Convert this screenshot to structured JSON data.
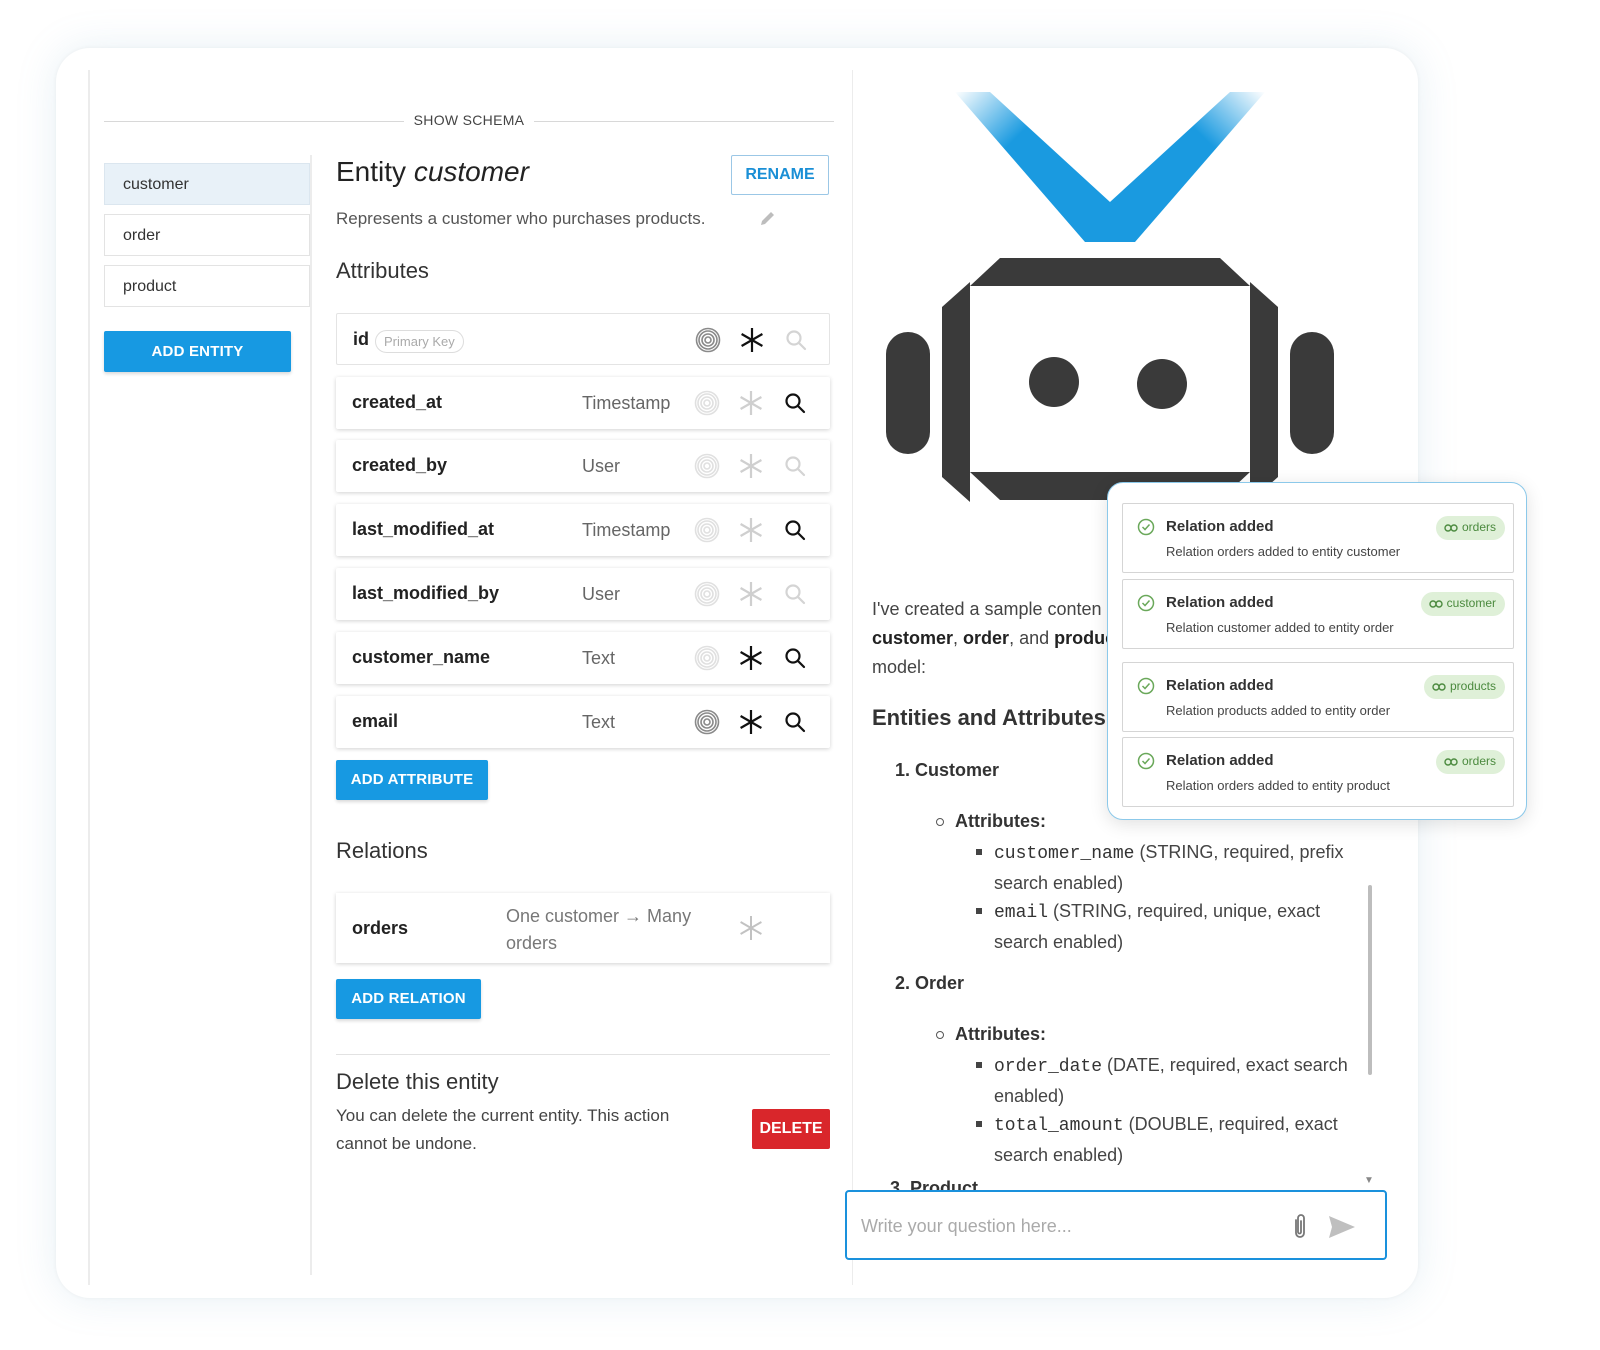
{
  "schema_header": "SHOW SCHEMA",
  "entities": [
    {
      "label": "customer",
      "active": true
    },
    {
      "label": "order",
      "active": false
    },
    {
      "label": "product",
      "active": false
    }
  ],
  "add_entity_label": "ADD ENTITY",
  "entity": {
    "title_prefix": "Entity",
    "name": "customer",
    "rename_label": "RENAME",
    "description": "Represents a customer who purchases products."
  },
  "attributes_title": "Attributes",
  "attributes": [
    {
      "name": "id",
      "type": "",
      "chip": "Primary Key",
      "fingerprint_active": true,
      "required_active": true,
      "search_active": false
    },
    {
      "name": "created_at",
      "type": "Timestamp",
      "fingerprint_active": false,
      "required_active": false,
      "search_active": true
    },
    {
      "name": "created_by",
      "type": "User",
      "fingerprint_active": false,
      "required_active": false,
      "search_active": false
    },
    {
      "name": "last_modified_at",
      "type": "Timestamp",
      "fingerprint_active": false,
      "required_active": false,
      "search_active": true
    },
    {
      "name": "last_modified_by",
      "type": "User",
      "fingerprint_active": false,
      "required_active": false,
      "search_active": false
    },
    {
      "name": "customer_name",
      "type": "Text",
      "fingerprint_active": false,
      "required_active": true,
      "search_active": true
    },
    {
      "name": "email",
      "type": "Text",
      "fingerprint_active": true,
      "required_active": true,
      "search_active": true
    }
  ],
  "add_attribute_label": "ADD ATTRIBUTE",
  "relations_title": "Relations",
  "relation": {
    "name": "orders",
    "description": "One customer → Many orders"
  },
  "add_relation_label": "ADD RELATION",
  "delete": {
    "title": "Delete this entity",
    "text": "You can delete the current entity. This action cannot be undone.",
    "button": "DELETE"
  },
  "chat": {
    "intro_start": "I've created a sample conten",
    "intro_b1": "customer",
    "intro_sep1": ", ",
    "intro_b2": "order",
    "intro_sep2": ", and ",
    "intro_b3": "produc",
    "intro_end": "model:",
    "heading": "Entities and Attributes:",
    "item1": "1. Customer",
    "item1_sub": "Attributes:",
    "item1_b1_code": "customer_name",
    "item1_b1_text": " (STRING, required, prefix search enabled)",
    "item1_b2_code": "email",
    "item1_b2_text": " (STRING, required, unique, exact search enabled)",
    "item2": "2. Order",
    "item2_sub": "Attributes:",
    "item2_b1_code": "order_date",
    "item2_b1_text": " (DATE, required, exact search enabled)",
    "item2_b2_code": "total_amount",
    "item2_b2_text": " (DOUBLE, required, exact search enabled)",
    "item3_partial": "3. Product",
    "input_placeholder": "Write your question here..."
  },
  "notifications": [
    {
      "title": "Relation added",
      "message": "Relation orders added to entity customer",
      "chip": "orders"
    },
    {
      "title": "Relation added",
      "message": "Relation customer added to entity order",
      "chip": "customer"
    },
    {
      "title": "Relation added",
      "message": "Relation products added to entity order",
      "chip": "products"
    },
    {
      "title": "Relation added",
      "message": "Relation orders added to entity product",
      "chip": "orders"
    }
  ],
  "colors": {
    "accent": "#1799e2",
    "danger": "#d9262b",
    "bot_dark": "#3a3a3a",
    "bot_blue": "#1a9ae0",
    "chip_bg": "#dff0d8"
  }
}
